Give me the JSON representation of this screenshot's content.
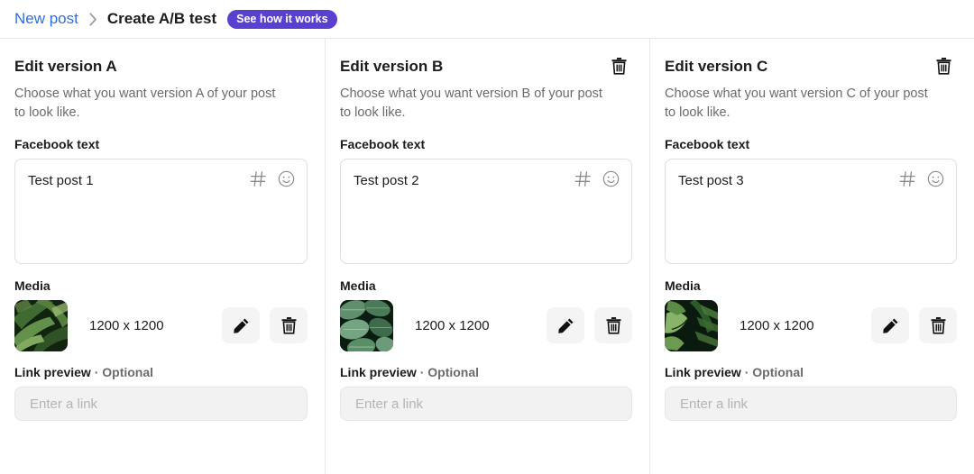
{
  "breadcrumb": {
    "parent_label": "New post",
    "separator_icon": "chevron-right-icon",
    "current_label": "Create A/B test",
    "badge_label": "See how it works",
    "badge_color": "#5a3fd0",
    "link_color": "#2e6fe0"
  },
  "common": {
    "facebook_text_label": "Facebook text",
    "media_label": "Media",
    "link_preview_label": "Link preview",
    "link_preview_optional_suffix": "· Optional",
    "link_placeholder": "Enter a link",
    "hashtag_icon": "hashtag-icon",
    "emoji_icon": "smiley-face-icon",
    "edit_icon": "pencil-icon",
    "delete_icon": "trash-icon"
  },
  "versions": [
    {
      "title": "Edit version A",
      "description": "Choose what you want version A of your post to look like.",
      "post_text": "Test post 1",
      "media_dimensions": "1200 x 1200",
      "link_value": "",
      "deletable": false,
      "thumbnail_alt": "tropical-palm-leaves"
    },
    {
      "title": "Edit version B",
      "description": "Choose what you want version B of your post to look like.",
      "post_text": "Test post 2",
      "media_dimensions": "1200 x 1200",
      "link_value": "",
      "deletable": true,
      "thumbnail_alt": "calathea-leaves"
    },
    {
      "title": "Edit version C",
      "description": "Choose what you want version C of your post to look like.",
      "post_text": "Test post 3",
      "media_dimensions": "1200 x 1200",
      "link_value": "",
      "deletable": true,
      "thumbnail_alt": "monstera-fern-leaves"
    }
  ]
}
